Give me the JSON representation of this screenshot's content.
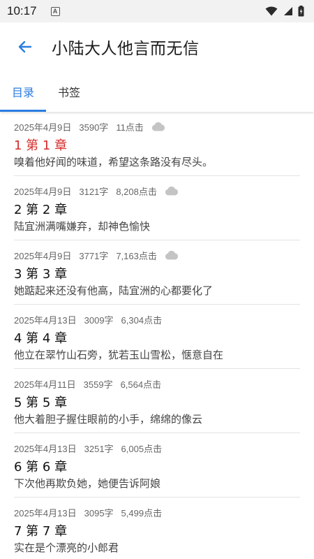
{
  "status_bar": {
    "time": "10:17",
    "notification_letter": "A"
  },
  "header": {
    "title": "小陆大人他言而无信"
  },
  "tabs": [
    {
      "label": "目录",
      "active": true
    },
    {
      "label": "书签",
      "active": false
    }
  ],
  "colors": {
    "accent": "#2a7de1",
    "current_chapter": "#d62b2b"
  },
  "chapters": [
    {
      "date": "2025年4月9日",
      "words": "3590字",
      "clicks": "11点击",
      "cloud": true,
      "title": "1 第 1 章",
      "summary": "嗅着他好闻的味道，希望这条路没有尽头。",
      "current": true
    },
    {
      "date": "2025年4月9日",
      "words": "3121字",
      "clicks": "8,208点击",
      "cloud": true,
      "title": "2 第 2 章",
      "summary": "陆宜洲满嘴嫌弃，却神色愉快",
      "current": false
    },
    {
      "date": "2025年4月9日",
      "words": "3771字",
      "clicks": "7,163点击",
      "cloud": true,
      "title": "3 第 3 章",
      "summary": "她踮起来还没有他高，陆宜洲的心都要化了",
      "current": false
    },
    {
      "date": "2025年4月13日",
      "words": "3009字",
      "clicks": "6,304点击",
      "cloud": false,
      "title": "4 第 4 章",
      "summary": "他立在翠竹山石旁，犹若玉山雪松，惬意自在",
      "current": false
    },
    {
      "date": "2025年4月11日",
      "words": "3559字",
      "clicks": "6,564点击",
      "cloud": false,
      "title": "5 第 5 章",
      "summary": "他大着胆子握住眼前的小手，绵绵的像云",
      "current": false
    },
    {
      "date": "2025年4月13日",
      "words": "3251字",
      "clicks": "6,005点击",
      "cloud": false,
      "title": "6 第 6 章",
      "summary": "下次他再欺负她，她便告诉阿娘",
      "current": false
    },
    {
      "date": "2025年4月13日",
      "words": "3095字",
      "clicks": "5,499点击",
      "cloud": false,
      "title": "7 第 7 章",
      "summary": "实在是个漂亮的小郎君",
      "current": false
    }
  ]
}
